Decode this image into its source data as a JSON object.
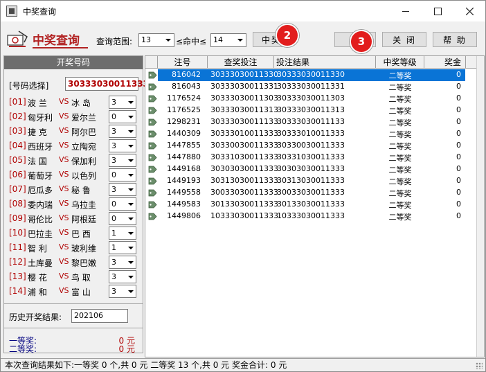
{
  "window": {
    "title": "中奖查询"
  },
  "toolbar": {
    "logo_text": "中奖查询",
    "range_label": "查询范围:",
    "range_from": "13",
    "hit_label": "≤命中≤",
    "range_to": "14",
    "query_btn": "中奖",
    "save_btn": "保",
    "close_btn": "关 闭",
    "help_btn": "帮 助"
  },
  "badges": [
    "1",
    "2",
    "3"
  ],
  "left": {
    "header": "开奖号码",
    "num_select_label": "[号码选择]",
    "num_select_value": "30333030011333",
    "matches": [
      {
        "idx": "[01]",
        "t1": "波  兰",
        "vs": "VS",
        "t2": "冰  岛",
        "val": "3"
      },
      {
        "idx": "[02]",
        "t1": "匈牙利",
        "vs": "VS",
        "t2": "爱尔兰",
        "val": "0"
      },
      {
        "idx": "[03]",
        "t1": "捷  克",
        "vs": "VS",
        "t2": "阿尔巴",
        "val": "3"
      },
      {
        "idx": "[04]",
        "t1": "西班牙",
        "vs": "VS",
        "t2": "立陶宛",
        "val": "3"
      },
      {
        "idx": "[05]",
        "t1": "法  国",
        "vs": "VS",
        "t2": "保加利",
        "val": "3"
      },
      {
        "idx": "[06]",
        "t1": "葡萄牙",
        "vs": "VS",
        "t2": "以色列",
        "val": "0"
      },
      {
        "idx": "[07]",
        "t1": "厄瓜多",
        "vs": "VS",
        "t2": "秘  鲁",
        "val": "3"
      },
      {
        "idx": "[08]",
        "t1": "委内瑞",
        "vs": "VS",
        "t2": "乌拉圭",
        "val": "0"
      },
      {
        "idx": "[09]",
        "t1": "哥伦比",
        "vs": "VS",
        "t2": "阿根廷",
        "val": "0"
      },
      {
        "idx": "[10]",
        "t1": "巴拉圭",
        "vs": "VS",
        "t2": "巴  西",
        "val": "1"
      },
      {
        "idx": "[11]",
        "t1": "智  利",
        "vs": "VS",
        "t2": "玻利维",
        "val": "1"
      },
      {
        "idx": "[12]",
        "t1": "土库曼",
        "vs": "VS",
        "t2": "黎巴嫩",
        "val": "3"
      },
      {
        "idx": "[13]",
        "t1": "樱  花",
        "vs": "VS",
        "t2": "鸟  取",
        "val": "3"
      },
      {
        "idx": "[14]",
        "t1": "浦  和",
        "vs": "VS",
        "t2": "富  山",
        "val": "3"
      }
    ],
    "history_label": "历史开奖结果:",
    "history_value": "202106",
    "prize1_label": "一等奖:",
    "prize1_amt": "0 元",
    "prize2_label": "二等奖:",
    "prize2_amt": "0 元"
  },
  "grid": {
    "columns": [
      "注号",
      "查奖投注",
      "投注结果",
      "中奖等级",
      "奖金"
    ],
    "rows": [
      {
        "no": "816042",
        "bet": "30333030011330",
        "res": "30333030011330",
        "lvl": "二等奖",
        "amt": "0"
      },
      {
        "no": "816043",
        "bet": "30333030011331",
        "res": "30333030011331",
        "lvl": "二等奖",
        "amt": "0"
      },
      {
        "no": "1176524",
        "bet": "30333030011303",
        "res": "30333030011303",
        "lvl": "二等奖",
        "amt": "0"
      },
      {
        "no": "1176525",
        "bet": "30333030011313",
        "res": "30333030011313",
        "lvl": "二等奖",
        "amt": "0"
      },
      {
        "no": "1298231",
        "bet": "30333030011133",
        "res": "30333030011133",
        "lvl": "二等奖",
        "amt": "0"
      },
      {
        "no": "1440309",
        "bet": "30333010011333",
        "res": "30333010011333",
        "lvl": "二等奖",
        "amt": "0"
      },
      {
        "no": "1447855",
        "bet": "30330030011333",
        "res": "30330030011333",
        "lvl": "二等奖",
        "amt": "0"
      },
      {
        "no": "1447880",
        "bet": "30331030011333",
        "res": "30331030011333",
        "lvl": "二等奖",
        "amt": "0"
      },
      {
        "no": "1449168",
        "bet": "30303030011333",
        "res": "30303030011333",
        "lvl": "二等奖",
        "amt": "0"
      },
      {
        "no": "1449193",
        "bet": "30313030011333",
        "res": "30313030011333",
        "lvl": "二等奖",
        "amt": "0"
      },
      {
        "no": "1449558",
        "bet": "30033030011333",
        "res": "30033030011333",
        "lvl": "二等奖",
        "amt": "0"
      },
      {
        "no": "1449583",
        "bet": "30133030011333",
        "res": "30133030011333",
        "lvl": "二等奖",
        "amt": "0"
      },
      {
        "no": "1449806",
        "bet": "10333030011333",
        "res": "10333030011333",
        "lvl": "二等奖",
        "amt": "0"
      }
    ]
  },
  "status": {
    "text": "本次查询结果如下:一等奖  0 个,共 0 元 二等奖  13 个,共 0 元 奖金合计: 0 元"
  },
  "colors": {
    "accent_red": "#b22222",
    "badge_red": "#e21d1d",
    "selection_blue": "#0a74d6",
    "header_gray": "#6d6d6d"
  }
}
